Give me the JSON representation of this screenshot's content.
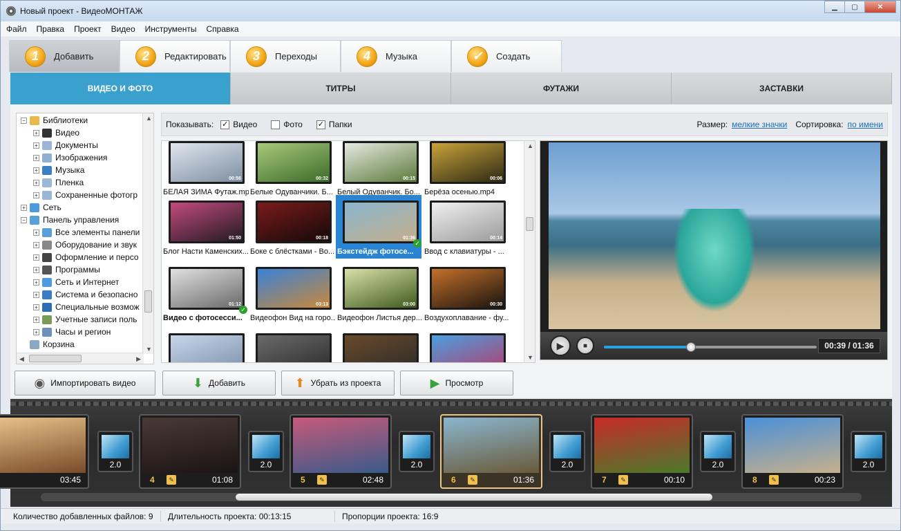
{
  "window": {
    "title": "Новый проект - ВидеоМОНТАЖ"
  },
  "menu": [
    "Файл",
    "Правка",
    "Проект",
    "Видео",
    "Инструменты",
    "Справка"
  ],
  "steps": [
    {
      "num": "1",
      "label": "Добавить"
    },
    {
      "num": "2",
      "label": "Редактировать"
    },
    {
      "num": "3",
      "label": "Переходы"
    },
    {
      "num": "4",
      "label": "Музыка"
    },
    {
      "num": "✓",
      "label": "Создать"
    }
  ],
  "categories": [
    "ВИДЕО И ФОТО",
    "ТИТРЫ",
    "ФУТАЖИ",
    "ЗАСТАВКИ"
  ],
  "tree": [
    {
      "label": "Библиотеки",
      "level": 0,
      "icon": "library-icon",
      "color": "#e8b84a",
      "box": "−"
    },
    {
      "label": "Видео",
      "level": 1,
      "icon": "video-folder-icon",
      "color": "#333",
      "box": "+"
    },
    {
      "label": "Документы",
      "level": 1,
      "icon": "documents-icon",
      "color": "#9bb6d6",
      "box": "+"
    },
    {
      "label": "Изображения",
      "level": 1,
      "icon": "images-icon",
      "color": "#8fb0d0",
      "box": "+"
    },
    {
      "label": "Музыка",
      "level": 1,
      "icon": "music-icon",
      "color": "#3b7fc7",
      "box": "+"
    },
    {
      "label": "Пленка",
      "level": 1,
      "icon": "film-icon",
      "color": "#9bb6d6",
      "box": "+"
    },
    {
      "label": "Сохраненные фотогр",
      "level": 1,
      "icon": "saved-photos-icon",
      "color": "#9bb6d6",
      "box": "+"
    },
    {
      "label": "Сеть",
      "level": 0,
      "icon": "network-icon",
      "color": "#4c9be0",
      "box": "+"
    },
    {
      "label": "Панель управления",
      "level": 0,
      "icon": "control-panel-icon",
      "color": "#5aa0d8",
      "box": "−"
    },
    {
      "label": "Все элементы панели",
      "level": 1,
      "icon": "all-items-icon",
      "color": "#5aa0d8",
      "box": "+"
    },
    {
      "label": "Оборудование и звук",
      "level": 1,
      "icon": "hardware-icon",
      "color": "#888",
      "box": "+"
    },
    {
      "label": "Оформление и персо",
      "level": 1,
      "icon": "appearance-icon",
      "color": "#444",
      "box": "+"
    },
    {
      "label": "Программы",
      "level": 1,
      "icon": "programs-icon",
      "color": "#555",
      "box": "+"
    },
    {
      "label": "Сеть и Интернет",
      "level": 1,
      "icon": "internet-icon",
      "color": "#4c9be0",
      "box": "+"
    },
    {
      "label": "Система и безопасно",
      "level": 1,
      "icon": "security-icon",
      "color": "#3a7bc8",
      "box": "+"
    },
    {
      "label": "Специальные возмож",
      "level": 1,
      "icon": "accessibility-icon",
      "color": "#2d6db5",
      "box": "+"
    },
    {
      "label": "Учетные записи поль",
      "level": 1,
      "icon": "users-icon",
      "color": "#7a9a5a",
      "box": "+"
    },
    {
      "label": "Часы и регион",
      "level": 1,
      "icon": "clock-icon",
      "color": "#6b8fb8",
      "box": "+"
    },
    {
      "label": "Корзина",
      "level": 0,
      "icon": "recycle-bin-icon",
      "color": "#8aa7c4",
      "box": ""
    }
  ],
  "filter": {
    "show_label": "Показывать:",
    "video_label": "Видео",
    "video_checked": true,
    "photo_label": "Фото",
    "photo_checked": false,
    "folders_label": "Папки",
    "folders_checked": true,
    "size_label": "Размер:",
    "size_value": "мелкие значки",
    "sort_label": "Сортировка:",
    "sort_value": "по имени"
  },
  "files": [
    {
      "name": "БЕЛАЯ ЗИМА Футаж.mp4",
      "dur": "00:56",
      "colors": [
        "#dfe6ee",
        "#7d8ea1"
      ]
    },
    {
      "name": "Белые Одуванчики. Б...",
      "dur": "00:32",
      "colors": [
        "#a8c97a",
        "#3c6b2a"
      ]
    },
    {
      "name": "Белый Одуванчик. Бо...",
      "dur": "00:15",
      "colors": [
        "#e6e9e1",
        "#5b7a3a"
      ]
    },
    {
      "name": "Берёза осенью.mp4",
      "dur": "00:06",
      "colors": [
        "#c9a23a",
        "#2d2a14"
      ]
    },
    {
      "name": "Блог Насти Каменских...",
      "dur": "01:50",
      "colors": [
        "#c24b7e",
        "#231a22"
      ]
    },
    {
      "name": "Боке с блёстками - Во...",
      "dur": "00:18",
      "colors": [
        "#7a1b1b",
        "#150909"
      ]
    },
    {
      "name": "Бэкстейдж фотосе...",
      "dur": "01:36",
      "colors": [
        "#8ab6cf",
        "#c3ad8a"
      ],
      "selected": true
    },
    {
      "name": "Ввод с клавиатуры - ...",
      "dur": "00:14",
      "colors": [
        "#f0f0f0",
        "#9a9a9a"
      ]
    },
    {
      "name": "Видео с фотосесси...",
      "dur": "01:12",
      "colors": [
        "#e0e0e0",
        "#6a6a6a"
      ],
      "bold": true,
      "checked": true
    },
    {
      "name": "Видеофон Вид на горо...",
      "dur": "03:13",
      "colors": [
        "#3a82d6",
        "#c9883a"
      ]
    },
    {
      "name": "Видеофон Листья дер...",
      "dur": "03:00",
      "colors": [
        "#d9e0a8",
        "#3f5a1e"
      ]
    },
    {
      "name": "Воздухоплавание - фу...",
      "dur": "00:30",
      "colors": [
        "#c4702a",
        "#1a1410"
      ]
    },
    {
      "name": "",
      "dur": "",
      "colors": [
        "#c8d6ea",
        "#7a8fa8"
      ]
    },
    {
      "name": "",
      "dur": "",
      "colors": [
        "#6a6a6a",
        "#2a2a2a"
      ]
    },
    {
      "name": "",
      "dur": "",
      "colors": [
        "#6a4a2a",
        "#2a2a2a"
      ]
    },
    {
      "name": "",
      "dur": "",
      "colors": [
        "#4aa0e0",
        "#b73a6a"
      ]
    }
  ],
  "player": {
    "time": "00:39 / 01:36",
    "progress": 0.41
  },
  "actions": {
    "import": "Импортировать видео",
    "add": "Добавить",
    "remove": "Убрать из проекта",
    "preview": "Просмотр"
  },
  "clips": [
    {
      "num": "",
      "dur": "03:45",
      "colors": [
        "#e8c38a",
        "#7a4a2a"
      ]
    },
    {
      "num": "4",
      "dur": "01:08",
      "colors": [
        "#4a3a34",
        "#1a1414"
      ]
    },
    {
      "num": "5",
      "dur": "02:48",
      "colors": [
        "#c65a7a",
        "#3a5a8a"
      ]
    },
    {
      "num": "6",
      "dur": "01:36",
      "colors": [
        "#8ab6cf",
        "#6a5a3a"
      ],
      "active": true
    },
    {
      "num": "7",
      "dur": "00:10",
      "colors": [
        "#c82a2a",
        "#4a7a2a"
      ]
    },
    {
      "num": "8",
      "dur": "00:23",
      "colors": [
        "#4a90d8",
        "#c6b08c"
      ]
    }
  ],
  "transitions": [
    "2.0",
    "2.0",
    "2.0",
    "2.0",
    "2.0",
    "2.0"
  ],
  "status": {
    "files": "Количество добавленных файлов: 9",
    "duration": "Длительность проекта:  00:13:15",
    "ratio": "Пропорции проекта:  16:9"
  }
}
